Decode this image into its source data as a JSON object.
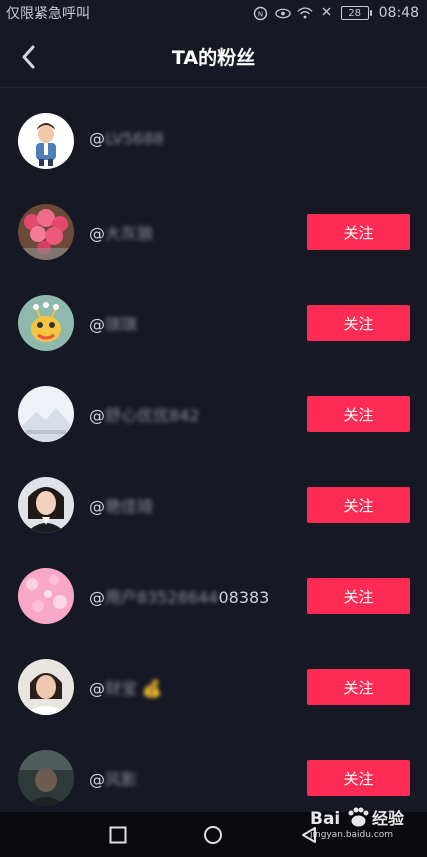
{
  "status_bar": {
    "carrier": "仅限紧急呼叫",
    "battery": "28",
    "time": "08:48"
  },
  "nav": {
    "title": "TA的粉丝"
  },
  "followers": [
    {
      "prefix": "@",
      "name": "LV5688",
      "suffix": "",
      "follow_label": ""
    },
    {
      "prefix": "@",
      "name": "大灰狼",
      "suffix": "",
      "follow_label": "关注"
    },
    {
      "prefix": "@",
      "name": "琪琪",
      "suffix": "",
      "follow_label": "关注"
    },
    {
      "prefix": "@",
      "name": "舒心优优842",
      "suffix": "",
      "follow_label": "关注"
    },
    {
      "prefix": "@",
      "name": "艳佳琦",
      "suffix": "",
      "follow_label": "关注"
    },
    {
      "prefix": "@",
      "name": "用户83528644",
      "suffix": "08383",
      "follow_label": "关注"
    },
    {
      "prefix": "@",
      "name": "财宝 💰",
      "suffix": "",
      "follow_label": "关注"
    },
    {
      "prefix": "@",
      "name": "风影",
      "suffix": "",
      "follow_label": "关注"
    }
  ],
  "watermark": {
    "logo": "Bai 经验",
    "url": "jingyan.baidu.com"
  },
  "colors": {
    "background": "#161823",
    "follow_button": "#fe2c55"
  }
}
